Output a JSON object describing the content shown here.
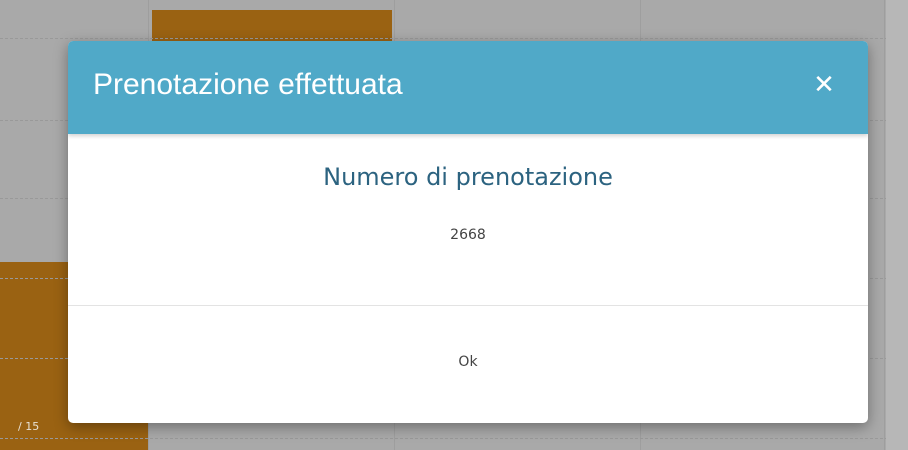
{
  "modal": {
    "title": "Prenotazione effettuata",
    "close_glyph": "✕",
    "heading": "Numero di prenotazione",
    "booking_number": "2668",
    "ok_label": "Ok"
  },
  "background": {
    "corner_label": "/ 15"
  },
  "colors": {
    "header": "#50a9c8",
    "heading_text": "#2c6380",
    "event_block": "#9a6212",
    "overlay": "#a9a9a9"
  }
}
